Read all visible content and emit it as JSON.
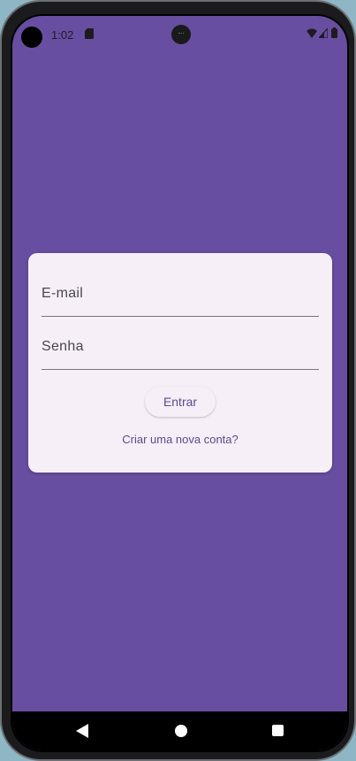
{
  "status_bar": {
    "time": "1:02",
    "icons": [
      "sd-card-icon",
      "wifi-icon",
      "signal-icon",
      "battery-icon"
    ]
  },
  "login_form": {
    "email_placeholder": "E-mail",
    "password_placeholder": "Senha",
    "submit_label": "Entrar",
    "create_account_link": "Criar uma nova conta?"
  },
  "navigation_bar": {
    "icons": [
      "back-icon",
      "home-icon",
      "recents-icon"
    ]
  },
  "colors": {
    "background": "#674ea0",
    "card": "#f6eff7",
    "accent_text": "#5e4a93",
    "field_text": "#49454f"
  }
}
